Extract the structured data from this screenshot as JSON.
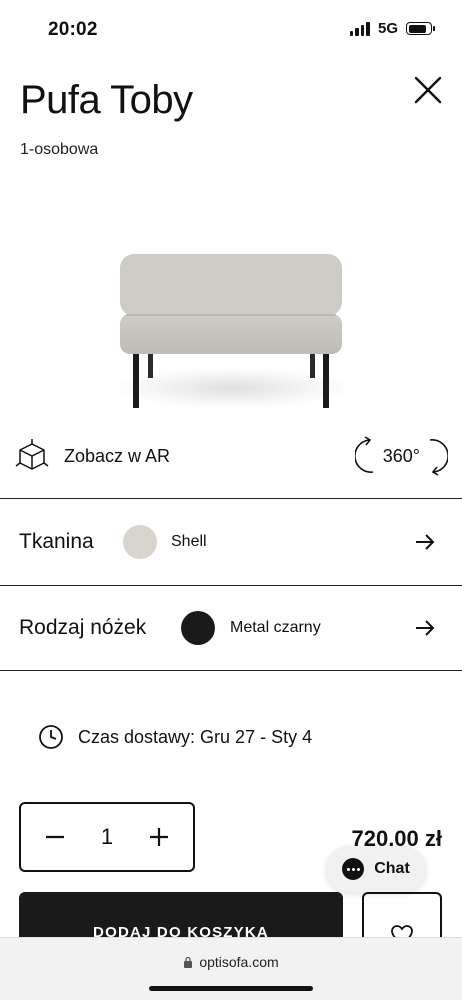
{
  "status": {
    "time": "20:02",
    "network": "5G",
    "battery_level": 0.85
  },
  "product": {
    "title": "Pufa Toby",
    "subtitle": "1-osobowa"
  },
  "actions": {
    "ar_label": "Zobacz w AR",
    "rotate_label": "360°"
  },
  "options": [
    {
      "label": "Tkanina",
      "value": "Shell",
      "swatch_color": "#d8d5cf"
    },
    {
      "label": "Rodzaj nóżek",
      "value": "Metal czarny",
      "swatch_color": "#1a1a1a"
    }
  ],
  "delivery": {
    "text": "Czas dostawy: Gru 27 - Sty 4"
  },
  "purchase": {
    "quantity": "1",
    "price": "720,00 zł",
    "add_to_cart": "DODAJ DO KOSZYKA"
  },
  "chat": {
    "label": "Chat"
  },
  "browser": {
    "url": "optisofa.com"
  }
}
